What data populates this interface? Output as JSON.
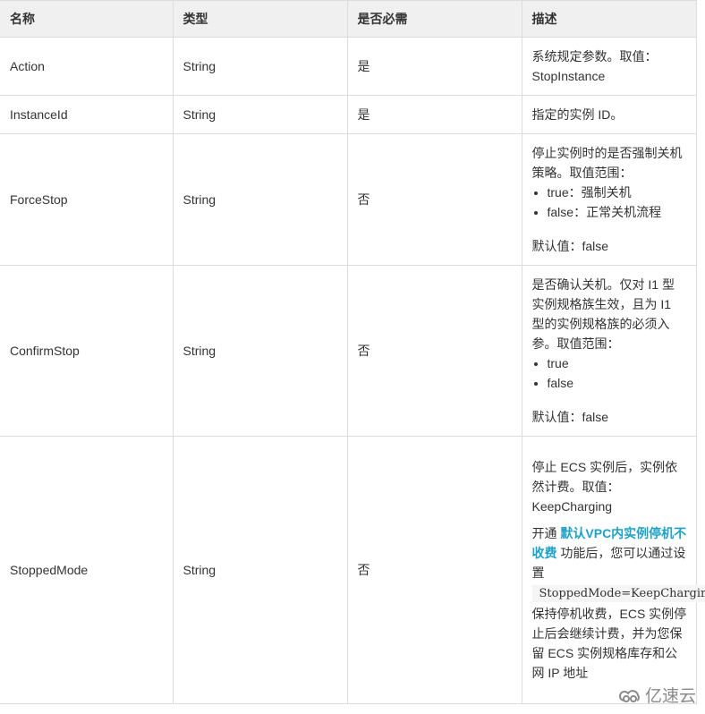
{
  "table": {
    "headers": [
      "名称",
      "类型",
      "是否必需",
      "描述"
    ],
    "rows": [
      {
        "name": "Action",
        "type": "String",
        "required": "是",
        "desc_lines": [
          "系统规定参数。取值：StopInstance"
        ]
      },
      {
        "name": "InstanceId",
        "type": "String",
        "required": "是",
        "desc_lines": [
          "指定的实例 ID。"
        ]
      },
      {
        "name": "ForceStop",
        "type": "String",
        "required": "否",
        "desc_intro": "停止实例时的是否强制关机策略。取值范围：",
        "desc_options": [
          "true：强制关机",
          "false：正常关机流程"
        ],
        "desc_default": "默认值：false"
      },
      {
        "name": "ConfirmStop",
        "type": "String",
        "required": "否",
        "desc_intro": "是否确认关机。仅对 I1 型实例规格族生效，且为 I1 型的实例规格族的必须入参。取值范围：",
        "desc_options": [
          "true",
          "false"
        ],
        "desc_default": "默认值：false"
      },
      {
        "name": "StoppedMode",
        "type": "String",
        "required": "否",
        "desc_intro": "停止 ECS 实例后，实例依然计费。取值：KeepCharging",
        "desc_para_prefix": "开通 ",
        "desc_link": "默认VPC内实例停机不收费",
        "desc_para_mid": " 功能后，您可以通过设置",
        "desc_code": "StoppedMode=KeepCharging",
        "desc_para_suffix": " 保持停机收费，ECS 实例停止后会继续计费，并为您保留 ECS 实例规格库存和公网 IP 地址"
      }
    ]
  },
  "watermark": {
    "icon": "yisu-cloud-logo-icon",
    "text": "亿速云"
  },
  "colors": {
    "link": "#1fa1c8",
    "header_bg": "#f0f0f0",
    "border": "#dcdcdc"
  }
}
